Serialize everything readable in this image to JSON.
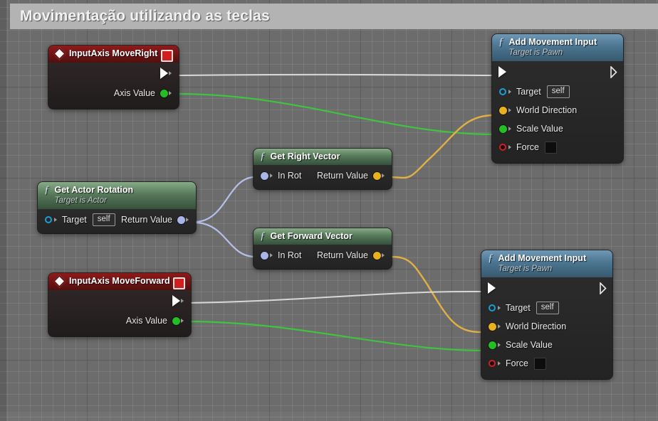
{
  "banner": {
    "title": "Movimentação utilizando as teclas"
  },
  "canvas": {
    "background_color": "#6c6c6c",
    "grid_minor_color": "#7d7d7d",
    "grid_major_color": "#4d4d4d"
  },
  "colors": {
    "exec_wire": "#d8d8d8",
    "float_wire": "#3ec43e",
    "vector_wire": "#e0b045",
    "rotator_wire": "#b6bfe8",
    "event_header": "#6d1313",
    "function_header_green": "#57795a",
    "function_header_blue": "#4c7591"
  },
  "nodes": [
    {
      "id": "input-axis-move-right",
      "kind": "event",
      "title": "InputAxis MoveRight",
      "subtitle": "",
      "icon": "event-diamond-icon",
      "has_delete_badge": true,
      "pins": [
        {
          "name": "exec-out",
          "label": "",
          "type": "exec",
          "side": "out",
          "shape": "filled-arrow"
        },
        {
          "name": "axis-value",
          "label": "Axis Value",
          "type": "float",
          "side": "out",
          "color": "#22c022"
        }
      ]
    },
    {
      "id": "add-movement-input-top",
      "kind": "function",
      "title": "Add Movement Input",
      "subtitle": "Target is Pawn",
      "icon": "function-f-icon",
      "pins": [
        {
          "name": "exec-in",
          "label": "",
          "type": "exec",
          "side": "in",
          "shape": "filled-arrow"
        },
        {
          "name": "exec-out",
          "label": "",
          "type": "exec",
          "side": "out",
          "shape": "hollow-arrow"
        },
        {
          "name": "target",
          "label": "Target",
          "type": "object",
          "side": "in",
          "value": "self",
          "color": "#189fd4"
        },
        {
          "name": "world-direction",
          "label": "World Direction",
          "type": "vector",
          "side": "in",
          "color": "#e9b11e"
        },
        {
          "name": "scale-value",
          "label": "Scale Value",
          "type": "float",
          "side": "in",
          "color": "#22c022"
        },
        {
          "name": "force",
          "label": "Force",
          "type": "bool",
          "side": "in",
          "value": "",
          "color": "#cf2020"
        }
      ]
    },
    {
      "id": "get-right-vector",
      "kind": "function",
      "title": "Get Right Vector",
      "subtitle": "",
      "icon": "function-f-icon",
      "pins": [
        {
          "name": "in-rot",
          "label": "In Rot",
          "type": "rotator",
          "side": "in",
          "color": "#a9b4e8"
        },
        {
          "name": "return-value",
          "label": "Return Value",
          "type": "vector",
          "side": "out",
          "color": "#e9b11e"
        }
      ]
    },
    {
      "id": "get-forward-vector",
      "kind": "function",
      "title": "Get Forward Vector",
      "subtitle": "",
      "icon": "function-f-icon",
      "pins": [
        {
          "name": "in-rot",
          "label": "In Rot",
          "type": "rotator",
          "side": "in",
          "color": "#a9b4e8"
        },
        {
          "name": "return-value",
          "label": "Return Value",
          "type": "vector",
          "side": "out",
          "color": "#e9b11e"
        }
      ]
    },
    {
      "id": "get-actor-rotation",
      "kind": "function",
      "title": "Get Actor Rotation",
      "subtitle": "Target is Actor",
      "icon": "function-f-icon",
      "pins": [
        {
          "name": "target",
          "label": "Target",
          "type": "object",
          "side": "in",
          "value": "self",
          "color": "#189fd4"
        },
        {
          "name": "return-value",
          "label": "Return Value",
          "type": "rotator",
          "side": "out",
          "color": "#a9b4e8"
        }
      ]
    },
    {
      "id": "input-axis-move-forward",
      "kind": "event",
      "title": "InputAxis MoveForward",
      "subtitle": "",
      "icon": "event-diamond-icon",
      "has_delete_badge": true,
      "pins": [
        {
          "name": "exec-out",
          "label": "",
          "type": "exec",
          "side": "out",
          "shape": "filled-arrow"
        },
        {
          "name": "axis-value",
          "label": "Axis Value",
          "type": "float",
          "side": "out",
          "color": "#22c022"
        }
      ]
    },
    {
      "id": "add-movement-input-bottom",
      "kind": "function",
      "title": "Add Movement Input",
      "subtitle": "Target is Pawn",
      "icon": "function-f-icon",
      "pins": [
        {
          "name": "exec-in",
          "label": "",
          "type": "exec",
          "side": "in",
          "shape": "filled-arrow"
        },
        {
          "name": "exec-out",
          "label": "",
          "type": "exec",
          "side": "out",
          "shape": "hollow-arrow"
        },
        {
          "name": "target",
          "label": "Target",
          "type": "object",
          "side": "in",
          "value": "self",
          "color": "#189fd4"
        },
        {
          "name": "world-direction",
          "label": "World Direction",
          "type": "vector",
          "side": "in",
          "color": "#e9b11e"
        },
        {
          "name": "scale-value",
          "label": "Scale Value",
          "type": "float",
          "side": "in",
          "color": "#22c022"
        },
        {
          "name": "force",
          "label": "Force",
          "type": "bool",
          "side": "in",
          "value": "",
          "color": "#cf2020"
        }
      ]
    }
  ],
  "labels": {
    "node1_title": "InputAxis MoveRight",
    "node1_axis_value": "Axis Value",
    "node2_title": "Add Movement Input",
    "node2_subtitle": "Target is Pawn",
    "node2_target": "Target",
    "node2_target_value": "self",
    "node2_world_direction": "World Direction",
    "node2_scale_value": "Scale Value",
    "node2_force": "Force",
    "node3_title": "Get Right Vector",
    "node3_in_rot": "In Rot",
    "node3_return_value": "Return Value",
    "node4_title": "Get Forward Vector",
    "node4_in_rot": "In Rot",
    "node4_return_value": "Return Value",
    "node5_title": "Get Actor Rotation",
    "node5_subtitle": "Target is Actor",
    "node5_target": "Target",
    "node5_target_value": "self",
    "node5_return_value": "Return Value",
    "node6_title": "InputAxis MoveForward",
    "node6_axis_value": "Axis Value",
    "node7_title": "Add Movement Input",
    "node7_subtitle": "Target is Pawn",
    "node7_target": "Target",
    "node7_target_value": "self",
    "node7_world_direction": "World Direction",
    "node7_scale_value": "Scale Value",
    "node7_force": "Force"
  },
  "connections": [
    {
      "from": "input-axis-move-right.exec-out",
      "to": "add-movement-input-top.exec-in",
      "type": "exec"
    },
    {
      "from": "input-axis-move-right.axis-value",
      "to": "add-movement-input-top.scale-value",
      "type": "float"
    },
    {
      "from": "get-actor-rotation.return-value",
      "to": "get-right-vector.in-rot",
      "type": "rotator"
    },
    {
      "from": "get-actor-rotation.return-value",
      "to": "get-forward-vector.in-rot",
      "type": "rotator"
    },
    {
      "from": "get-right-vector.return-value",
      "to": "add-movement-input-top.world-direction",
      "type": "vector"
    },
    {
      "from": "get-forward-vector.return-value",
      "to": "add-movement-input-bottom.world-direction",
      "type": "vector"
    },
    {
      "from": "input-axis-move-forward.exec-out",
      "to": "add-movement-input-bottom.exec-in",
      "type": "exec"
    },
    {
      "from": "input-axis-move-forward.axis-value",
      "to": "add-movement-input-bottom.scale-value",
      "type": "float"
    }
  ]
}
